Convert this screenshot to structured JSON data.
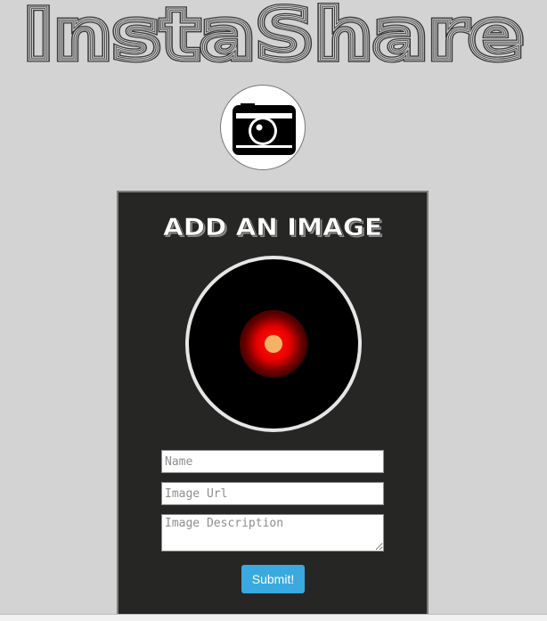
{
  "header": {
    "logo_text": "InstaShare"
  },
  "card": {
    "title": "ADD AN IMAGE",
    "form": {
      "name_placeholder": "Name",
      "url_placeholder": "Image Url",
      "description_placeholder": "Image Description",
      "submit_label": "Submit!"
    }
  },
  "icons": {
    "badge": "camera-icon",
    "preview": "hal-eye-icon"
  },
  "colors": {
    "page_background": "#d3d3d3",
    "card_background": "#262624",
    "submit_button": "#3aa9df",
    "eye_red": "#ff1a0c",
    "eye_core": "#f4b266"
  }
}
